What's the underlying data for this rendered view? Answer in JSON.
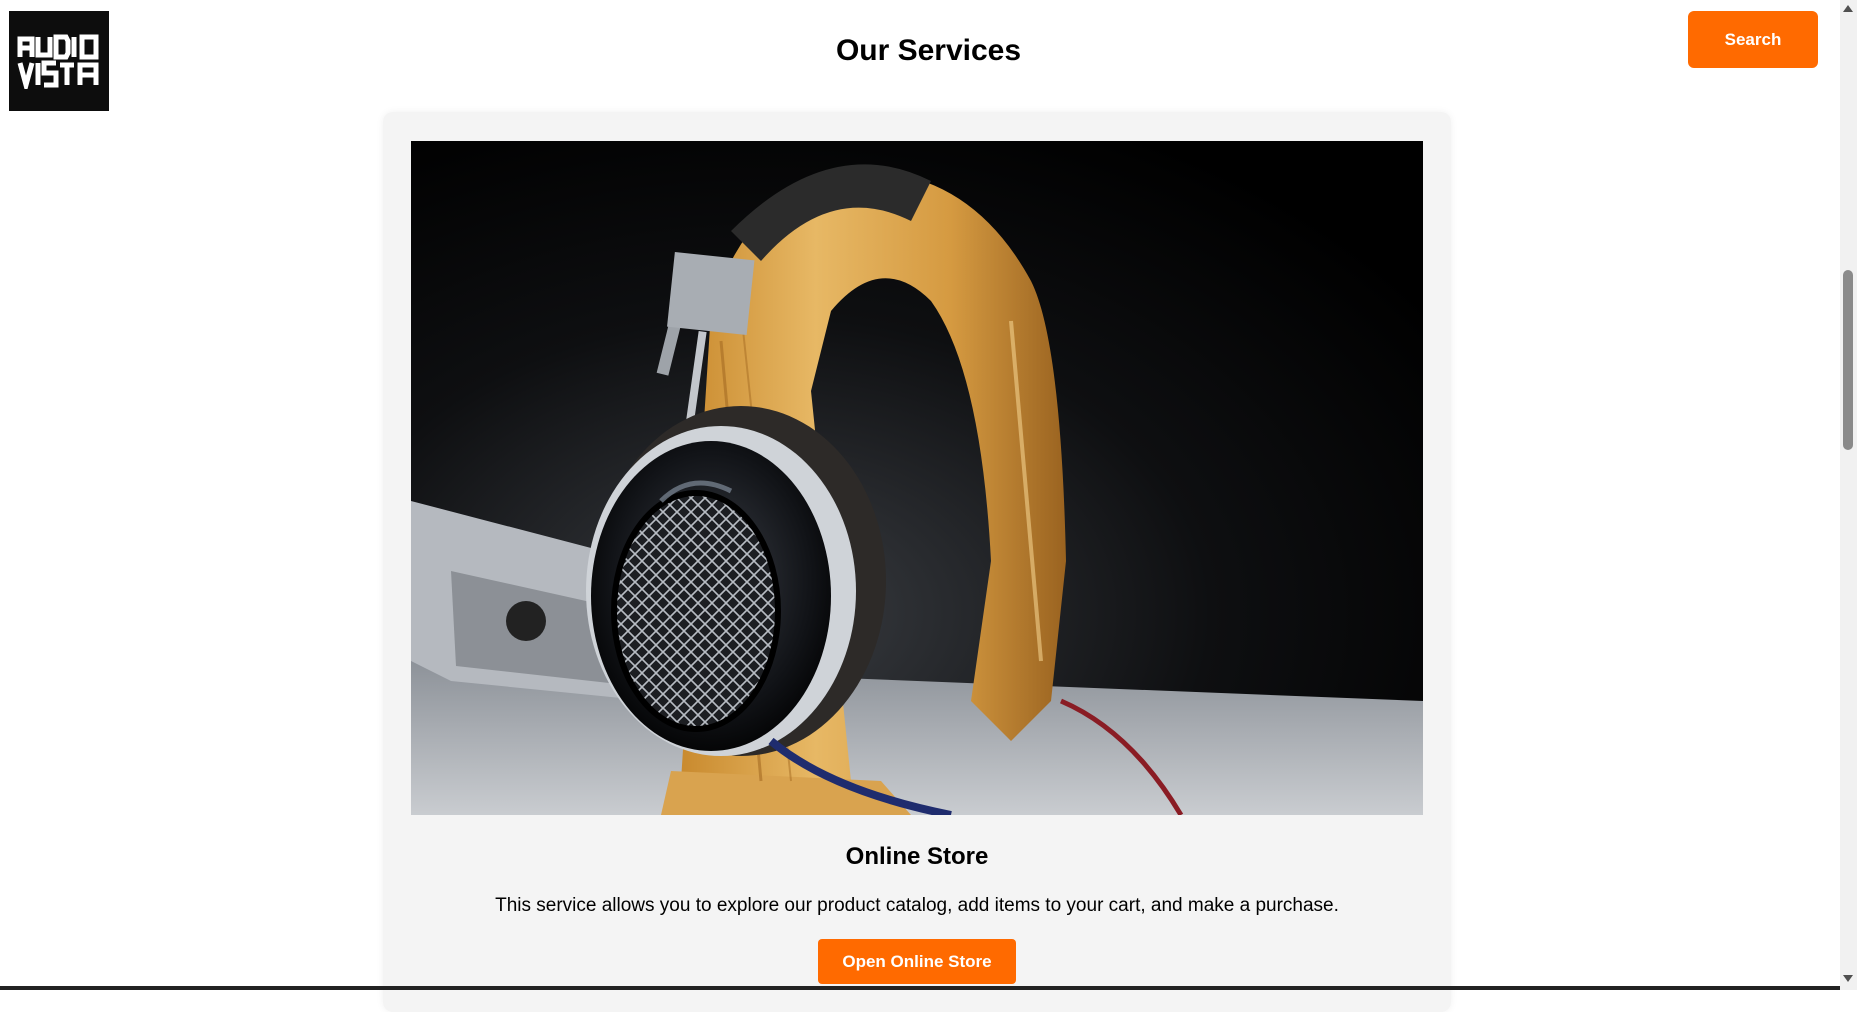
{
  "header": {
    "logo_alt": "AUDIO VISTA",
    "title": "Our Services",
    "search_label": "Search"
  },
  "service": {
    "title": "Online Store",
    "description": "This service allows you to explore our product catalog, add items to your cart, and make a purchase.",
    "button_label": "Open Online Store",
    "image_subject": "headphones on wooden stand"
  },
  "colors": {
    "accent": "#ff6a00",
    "card_background": "#f4f4f4",
    "logo_background": "#0d0d0d"
  }
}
